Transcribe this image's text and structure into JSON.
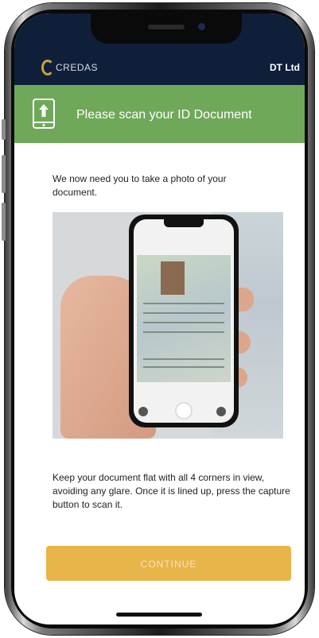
{
  "header": {
    "logo_text": "CREDAS",
    "org_name": "DT Ltd"
  },
  "banner": {
    "icon": "upload-phone-icon",
    "title": "Please scan your ID Document"
  },
  "content": {
    "intro": "We now need you to take a photo of your document.",
    "illustration": "phone-scanning-id-photo",
    "instructions": "Keep your document flat with all 4 corners in view, avoiding any glare. Once it is lined up, press the capture button to scan it."
  },
  "actions": {
    "continue_label": "CONTINUE"
  },
  "colors": {
    "header_bg": "#0f1f3a",
    "banner_bg": "#6fa859",
    "button_bg": "#e8b54a",
    "logo_gold": "#c9a23a"
  }
}
